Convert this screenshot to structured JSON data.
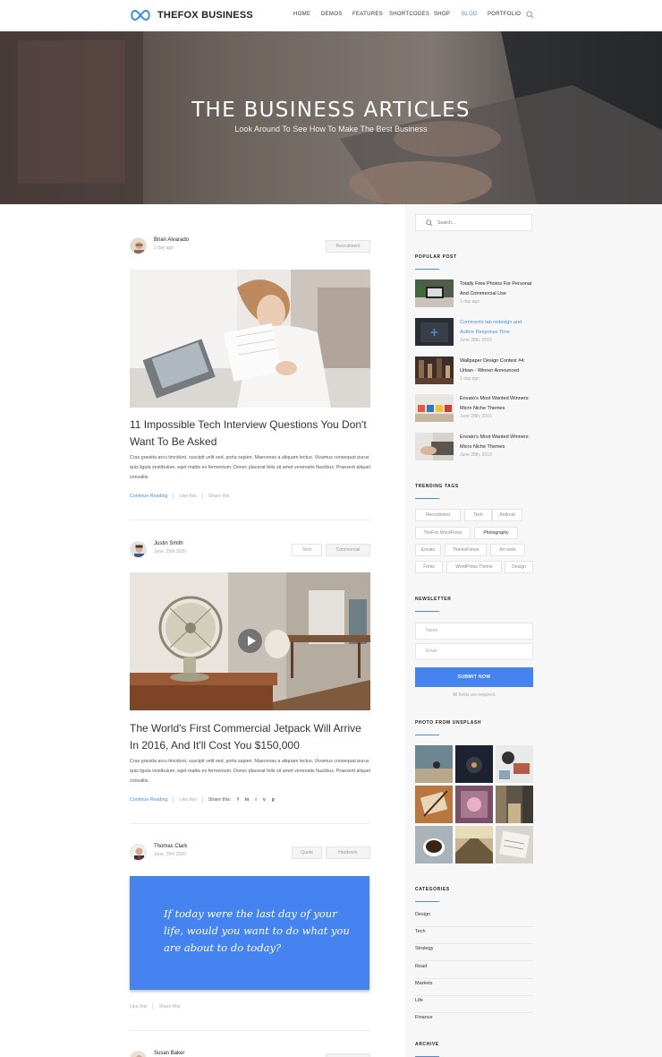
{
  "header": {
    "brand": "THEFOX BUSINESS",
    "nav": [
      "HOME",
      "DEMOS",
      "FEATURES",
      "SHORTCODES",
      "SHOP",
      "BLOG",
      "PORTFOLIO"
    ],
    "active_nav": "BLOG",
    "accent": "#4a8ee4"
  },
  "hero": {
    "title": "THE BUSINESS ARTICLES",
    "subtitle": "Look Around To See How To Make The Best Business"
  },
  "sidebar": {
    "search_placeholder": "Search...",
    "popular_heading": "POPULAR POST",
    "popular": [
      {
        "title": "Totally Free Photos For Personal And Commercial Use",
        "date": "1 day ago"
      },
      {
        "title": "Comments tab redesign and Author Response Time",
        "date": "June 28th, 2015"
      },
      {
        "title": "Wallpaper Design Contest #4: Urban - Winner Announced",
        "date": "1 day ago"
      },
      {
        "title": "Envato's Most Wanted Winners: Micro Niche Themes",
        "date": "June 28th, 2015"
      },
      {
        "title": "Envato's Most Wanted Winners: Micro Niche Themes",
        "date": "June 28th, 2015"
      }
    ],
    "tags_heading": "TRENDING TAGS",
    "tags": [
      "Recruitment",
      "Tech",
      "Android",
      "TheFox WordPress",
      "Photography",
      "Envato",
      "ThemeForest",
      "Art work",
      "Fonts",
      "WordPress Theme",
      "Design"
    ],
    "newsletter_heading": "NEWSLETTER",
    "newsletter_name": "Name",
    "newsletter_email": "Email",
    "newsletter_button": "SUBMIT NOW",
    "newsletter_note": "All fields are required.",
    "photos_heading": "PHOTO FROM UNSPLASH",
    "categories_heading": "CATEGORIES",
    "categories": [
      "Design",
      "Tech",
      "Strategy",
      "Read",
      "Markets",
      "Life",
      "Finance"
    ],
    "archive_heading": "ARCHIVE"
  },
  "posts": [
    {
      "author": "Brian Alvarado",
      "date": "1 day ago",
      "tags": [
        "Recruitment"
      ],
      "title": "11 Impossible Tech Interview Questions You Don't Want To Be Asked",
      "excerpt": "Cras gravida arcu tincidunt, suscipit velit sed, porta sapien. Maecenas a aliquam lectus. Vivamus consequat purus quis ligula vestibulum, eget mattis ex fermentum. Donec placerat felis sit amet venenatis faucibus. Praesent aliquet convallis.",
      "continue": "Continue Reading",
      "like": "Like this",
      "share": "Share this"
    },
    {
      "author": "Justin Smith",
      "date": "June, 25th 2020",
      "tags": [
        "Tech",
        "Commercial"
      ],
      "title": "The World's First Commercial Jetpack Will Arrive In 2016, And It'll Cost You $150,000",
      "excerpt": "Cras gravida arcu tincidunt, suscipit velit sed, porta sapien. Maecenas a aliquam lectus. Vivamus consequat purus quis ligula vestibulum, eget mattis ex fermentum. Donec placerat felis sit amet venenatis faucibus. Praesent aliquet convallis.",
      "continue": "Continue Reading",
      "like": "Like this",
      "share": "Share this:",
      "share_icons": [
        "f",
        "in",
        "t",
        "v",
        "p"
      ]
    },
    {
      "author": "Thomas Clark",
      "date": "June, 25th 2020",
      "tags": [
        "Quote",
        "Hardwork"
      ],
      "quote": "If today were the last day of your life, would you want to do what you are about to do today?",
      "like": "Like this",
      "share": "Share this"
    },
    {
      "author": "Susan Baker"
    }
  ]
}
